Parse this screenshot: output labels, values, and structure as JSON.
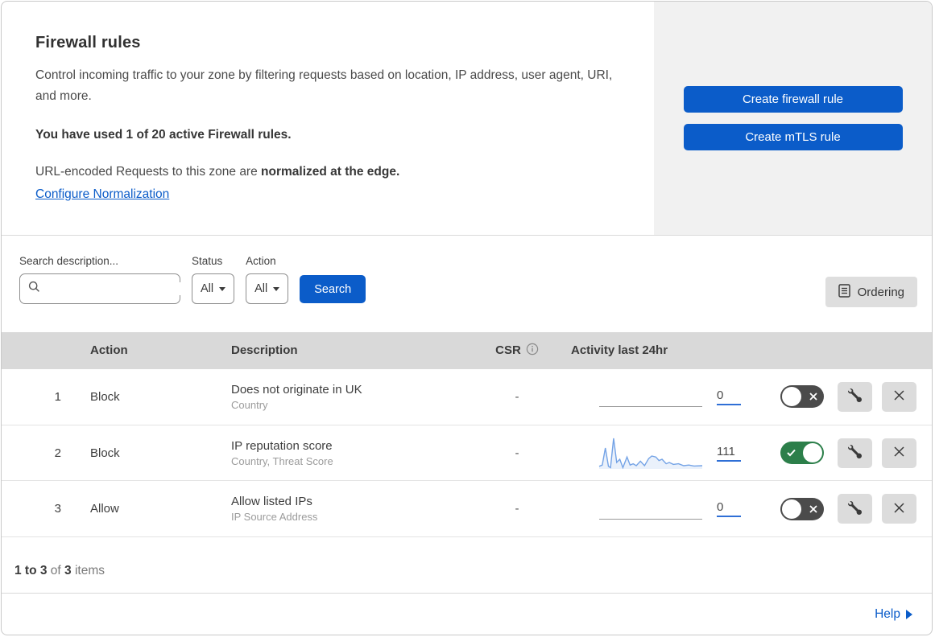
{
  "header": {
    "title": "Firewall rules",
    "description": "Control incoming traffic to your zone by filtering requests based on location, IP address, user agent, URI, and more.",
    "usage_note": "You have used 1 of 20 active Firewall rules.",
    "normalization_prefix": "URL-encoded Requests to this zone are",
    "normalization_bold": "normalized at the edge.",
    "normalization_link": "Configure Normalization",
    "create_firewall_button": "Create firewall rule",
    "create_mtls_button": "Create mTLS rule"
  },
  "filters": {
    "search_label": "Search description...",
    "search_value": "",
    "status_label": "Status",
    "status_value": "All",
    "action_label": "Action",
    "action_value": "All",
    "search_button": "Search",
    "ordering_button": "Ordering"
  },
  "table": {
    "columns": {
      "action": "Action",
      "description": "Description",
      "csr": "CSR",
      "activity": "Activity last 24hr"
    },
    "rows": [
      {
        "index": "1",
        "action": "Block",
        "description": "Does not originate in UK",
        "criteria": "Country",
        "csr": "-",
        "activity_count": "0",
        "enabled": false
      },
      {
        "index": "2",
        "action": "Block",
        "description": "IP reputation score",
        "criteria": "Country, Threat Score",
        "csr": "-",
        "activity_count": "111",
        "enabled": true,
        "sparkline": [
          [
            0,
            92
          ],
          [
            3,
            88
          ],
          [
            6,
            35
          ],
          [
            9,
            92
          ],
          [
            11,
            96
          ],
          [
            14,
            5
          ],
          [
            17,
            80
          ],
          [
            20,
            70
          ],
          [
            23,
            96
          ],
          [
            27,
            63
          ],
          [
            30,
            88
          ],
          [
            33,
            84
          ],
          [
            36,
            90
          ],
          [
            40,
            76
          ],
          [
            44,
            90
          ],
          [
            48,
            68
          ],
          [
            51,
            60
          ],
          [
            55,
            63
          ],
          [
            58,
            74
          ],
          [
            61,
            70
          ],
          [
            65,
            84
          ],
          [
            68,
            80
          ],
          [
            72,
            86
          ],
          [
            77,
            84
          ],
          [
            82,
            90
          ],
          [
            87,
            88
          ],
          [
            92,
            91
          ],
          [
            100,
            90
          ]
        ]
      },
      {
        "index": "3",
        "action": "Allow",
        "description": "Allow listed IPs",
        "criteria": "IP Source Address",
        "csr": "-",
        "activity_count": "0",
        "enabled": false
      }
    ],
    "footer": {
      "range": "1 to 3",
      "of": "of",
      "total": "3",
      "items": "items"
    }
  },
  "help": {
    "label": "Help"
  },
  "colors": {
    "accent_blue": "#0b5cc9",
    "toggle_on_green": "#2c7f4a",
    "toggle_off_gray": "#4b4b4b",
    "sparkline_blue": "#74a3e6",
    "table_header_gray": "#d9d9d9"
  }
}
